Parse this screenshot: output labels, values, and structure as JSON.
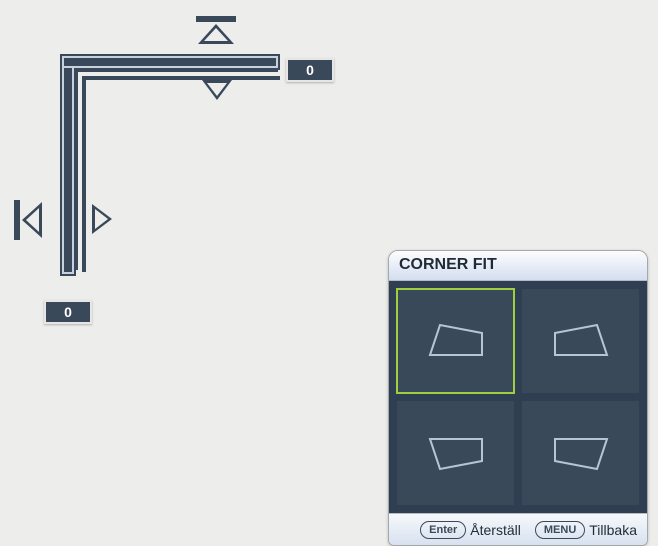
{
  "corner_control": {
    "h_value": "0",
    "v_value": "0"
  },
  "panel": {
    "title": "CORNER FIT",
    "options": [
      {
        "id": "top-left",
        "selected": true
      },
      {
        "id": "top-right",
        "selected": false
      },
      {
        "id": "bottom-left",
        "selected": false
      },
      {
        "id": "bottom-right",
        "selected": false
      }
    ],
    "footer": {
      "enter_key": "Enter",
      "enter_label": "Återställ",
      "menu_key": "MENU",
      "menu_label": "Tillbaka"
    }
  },
  "colors": {
    "dark": "#39495a",
    "accent": "#9fcf3f",
    "outline_light": "#b6c5d6"
  }
}
